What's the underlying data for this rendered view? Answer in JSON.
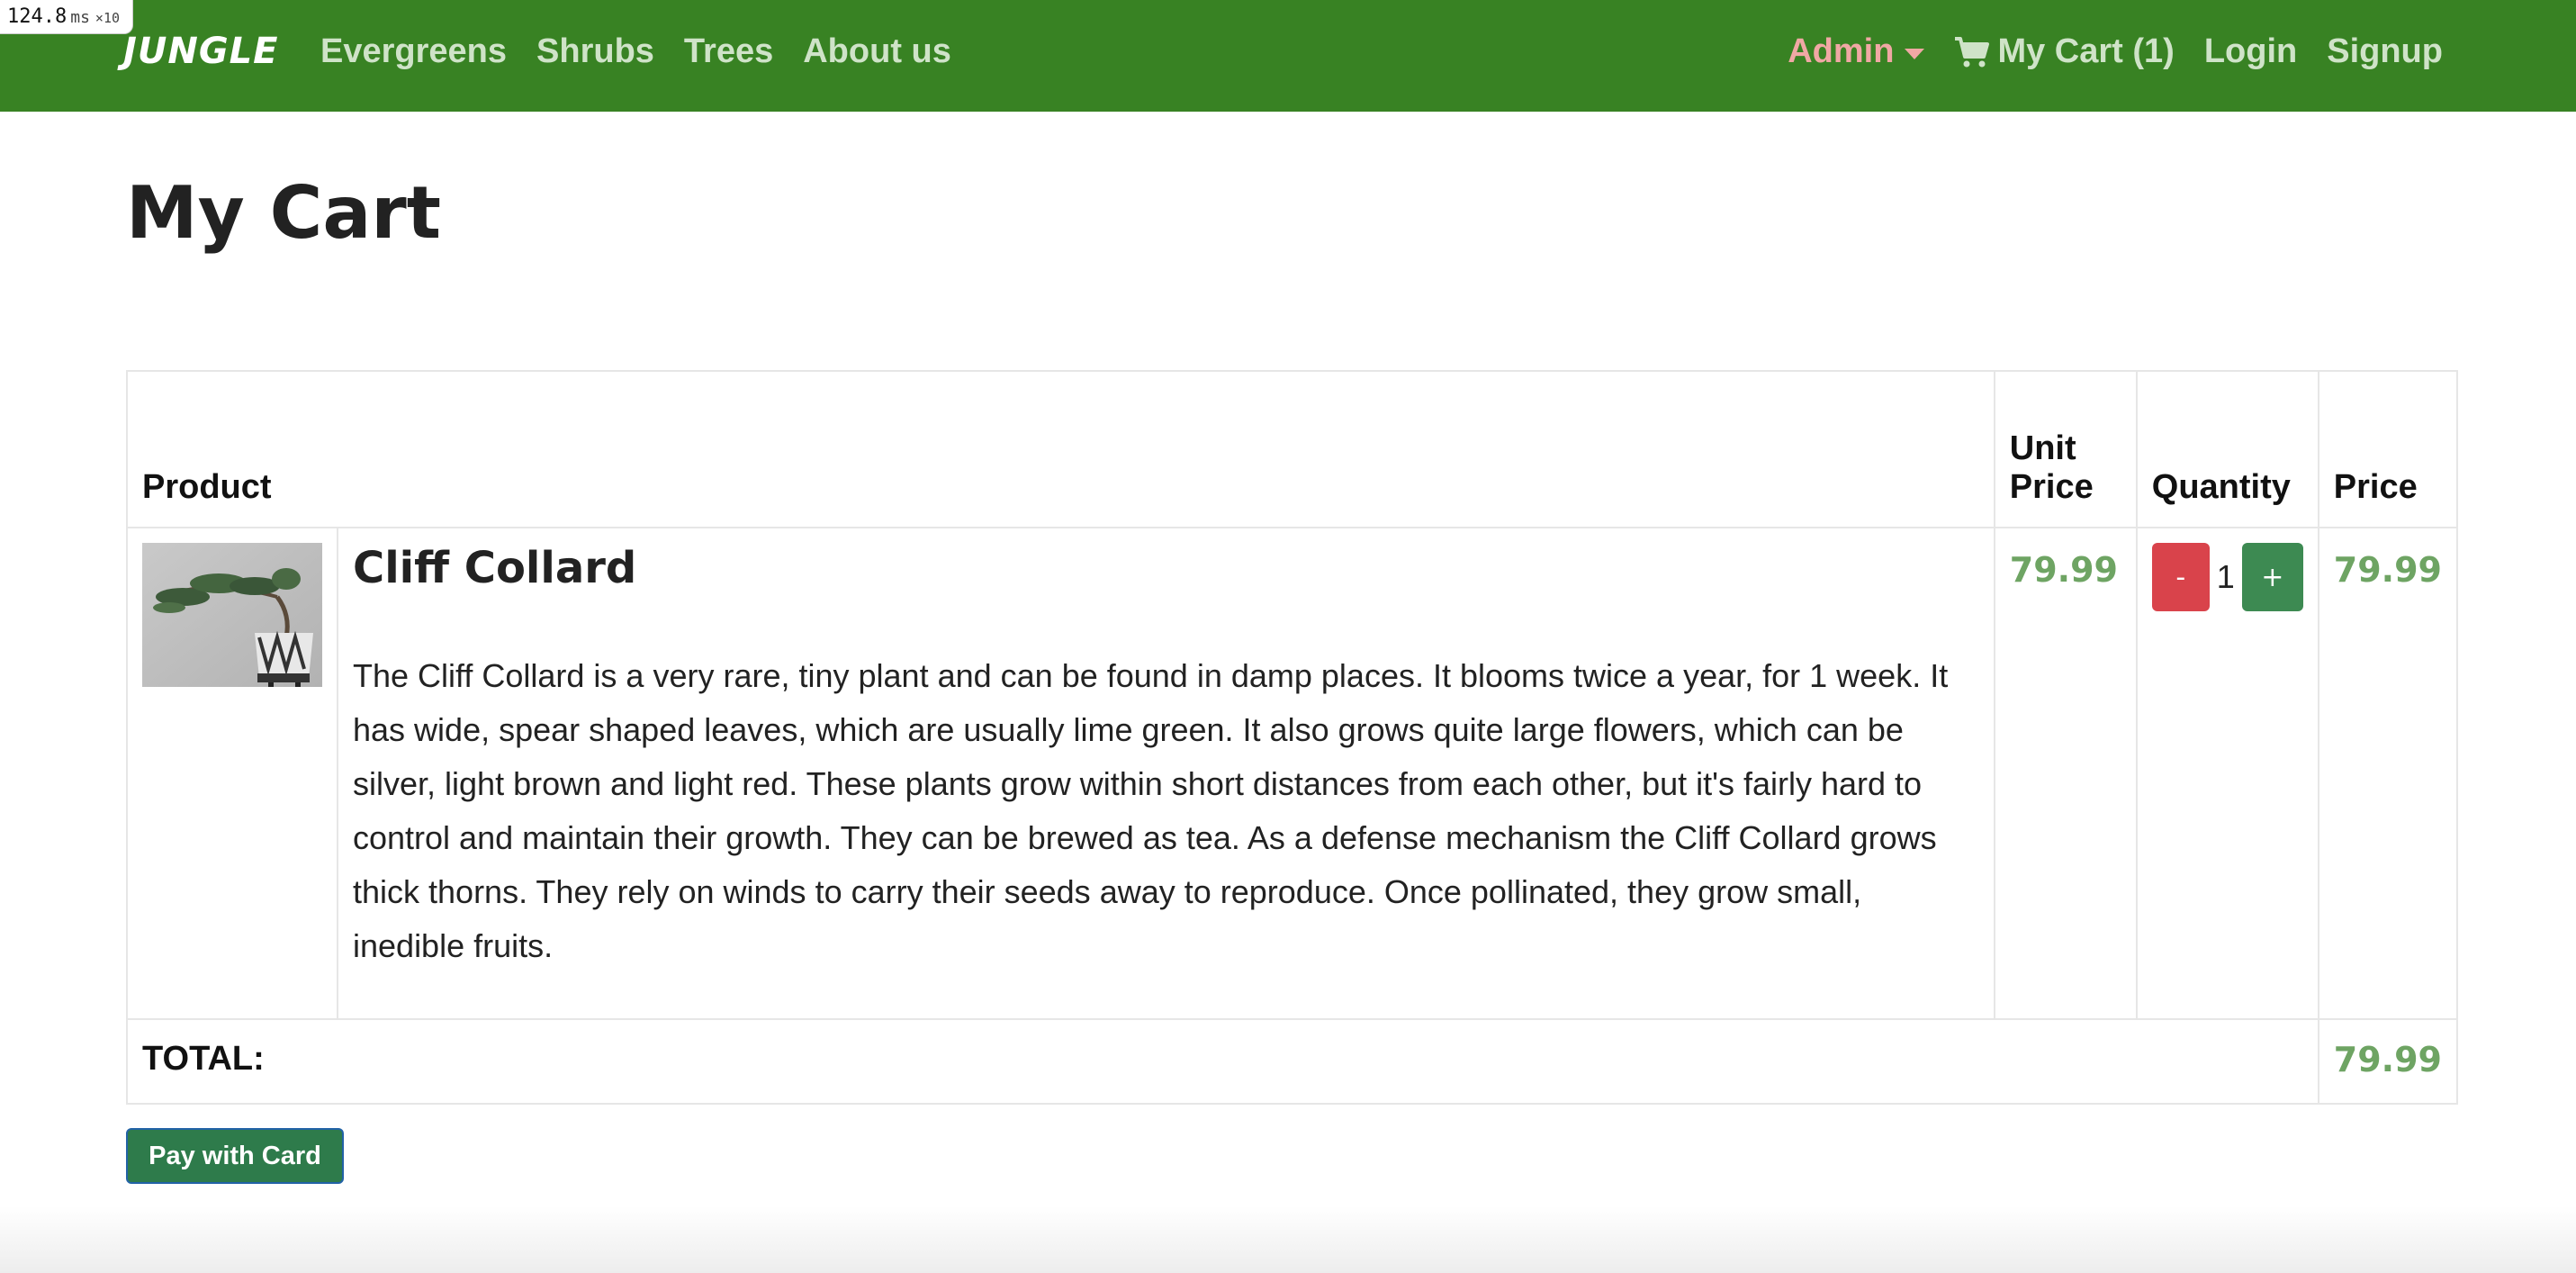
{
  "perf": {
    "value": "124.8",
    "unit": "ms",
    "multiplier": "×10"
  },
  "navbar": {
    "brand": "JUNGLE",
    "left_links": [
      "Evergreens",
      "Shrubs",
      "Trees",
      "About us"
    ],
    "admin_label": "Admin",
    "cart_label": "My Cart (1)",
    "login_label": "Login",
    "signup_label": "Signup"
  },
  "page": {
    "title": "My Cart"
  },
  "table": {
    "headers": {
      "product": "Product",
      "unit_price": "Unit Price",
      "quantity": "Quantity",
      "price": "Price"
    },
    "items": [
      {
        "name": "Cliff Collard",
        "description": "The Cliff Collard is a very rare, tiny plant and can be found in damp places. It blooms twice a year, for 1 week. It has wide, spear shaped leaves, which are usually lime green. It also grows quite large flowers, which can be silver, light brown and light red. These plants grow within short distances from each other, but it's fairly hard to control and maintain their growth. They can be brewed as tea. As a defense mechanism the Cliff Collard grows thick thorns. They rely on winds to carry their seeds away to reproduce. Once pollinated, they grow small, inedible fruits.",
        "unit_price": "79.99",
        "quantity": "1",
        "decrement_label": "-",
        "increment_label": "+",
        "price": "79.99"
      }
    ],
    "total_label": "TOTAL:",
    "total_value": "79.99"
  },
  "checkout": {
    "pay_label": "Pay with Card"
  },
  "colors": {
    "navbar": "#388223",
    "price": "#6ea463",
    "minus": "#d9434b",
    "plus": "#3d8a52",
    "pay": "#2e7b4b"
  }
}
